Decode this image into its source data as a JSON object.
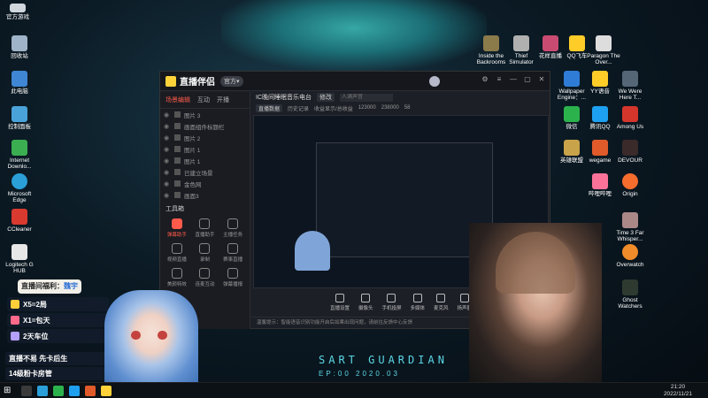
{
  "window": {
    "app_title": "直播伴侣",
    "version_label": "官方▾",
    "tabs": [
      "场景编辑",
      "互动",
      "开播"
    ],
    "scenes": [
      "图片 3",
      "画面组件标题栏",
      "图片 2",
      "图片 1",
      "图片 1",
      "已建立场景",
      "金色网",
      "画面3"
    ],
    "tools_label": "工具箱",
    "tools": [
      "弹幕助手",
      "直播助手",
      "主播任务",
      "视频直播",
      "录制",
      "赛事直播",
      "美颜特效",
      "连麦互动",
      "弹幕播报"
    ],
    "room_title": "IC晚间睡眠音乐电台",
    "room_btn": "修改",
    "room_placeholder": "人满声音",
    "stats": [
      "直播数据",
      "历史记录",
      "收益显示/总收益",
      "123000",
      "238000",
      "58"
    ],
    "bottom_actions": [
      "直播设置",
      "摄像头",
      "手机投屏",
      "多媒体",
      "麦克风",
      "扬声器"
    ],
    "notice": "温馨提示：智能语音识别功能开启后如果出现问题，请前往反馈中心反馈"
  },
  "overlay": {
    "title_prefix": "直播间福利：",
    "title_name": "魏宇",
    "rules": [
      "X5=2局",
      "X1=包天",
      "2天车位"
    ],
    "footer": [
      "直播不易 先卡后生",
      "14级粉卡房管"
    ]
  },
  "desktop": {
    "left_icons": [
      "回收站",
      "此电脑",
      "控制面板",
      "Internet Downlo...",
      "Microsoft Edge",
      "CCleaner",
      "Logitech G HUB"
    ],
    "right_icons": [
      "Inside the Backrooms",
      "Thief Simulator",
      "花样直播",
      "QQ飞车",
      "Paragon The Over...",
      "Wallpaper Engine：...",
      "YY语音",
      "We Were Here T...",
      "微信",
      "腾讯QQ",
      "Among Us",
      "英雄联盟",
      "wegame",
      "DEVOUR",
      "哔哩哔哩",
      "Origin",
      "Time 3 Far Whisper...",
      "Overwatch",
      "Ghost Watchers"
    ],
    "wallpaper_title": "SART GUARDIAN",
    "wallpaper_sub": "EP:00 2020.03",
    "top_left_stamp": "官方游戏"
  },
  "taskbar": {
    "time": "21:20",
    "date": "2022/11/21"
  },
  "colors": {
    "accent": "#ff5a4a",
    "teal": "#3fc7c0"
  }
}
